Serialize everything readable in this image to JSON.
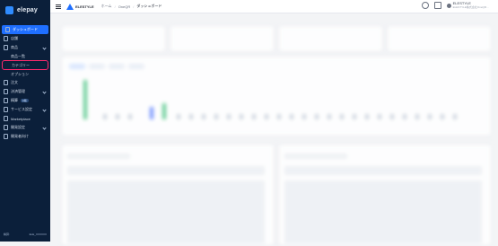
{
  "app": {
    "name": "elepay",
    "brand": "ELESTYLE",
    "breadcrumbs": [
      "ホーム",
      "OneQR",
      "ダッシュボード"
    ],
    "user": {
      "name": "ELESTYLE",
      "sub": "ELESTYLE株式会社OneQR…"
    }
  },
  "sidebar": {
    "items": [
      {
        "label": "ダッシュボード",
        "active": true
      },
      {
        "label": "店舗"
      },
      {
        "label": "商品",
        "expandable": true
      },
      {
        "label": "商品一覧",
        "sub": true
      },
      {
        "label": "カテゴリー",
        "sub": true,
        "highlight": true
      },
      {
        "label": "オプション",
        "sub": true
      },
      {
        "label": "注文"
      },
      {
        "label": "決済管理",
        "expandable": true
      },
      {
        "label": "精算",
        "badge": "β版"
      },
      {
        "label": "サービス設定",
        "expandable": true
      },
      {
        "label": "Marketplace"
      },
      {
        "label": "開発設定",
        "expandable": true
      },
      {
        "label": "開発者向け"
      }
    ],
    "footer": {
      "left_label": "精算:",
      "value": "ELE_XXXXXX"
    }
  },
  "colors": {
    "sidebar_bg": "#0b1f3a",
    "accent": "#1f6fff",
    "highlight": "#ff2a6d"
  }
}
